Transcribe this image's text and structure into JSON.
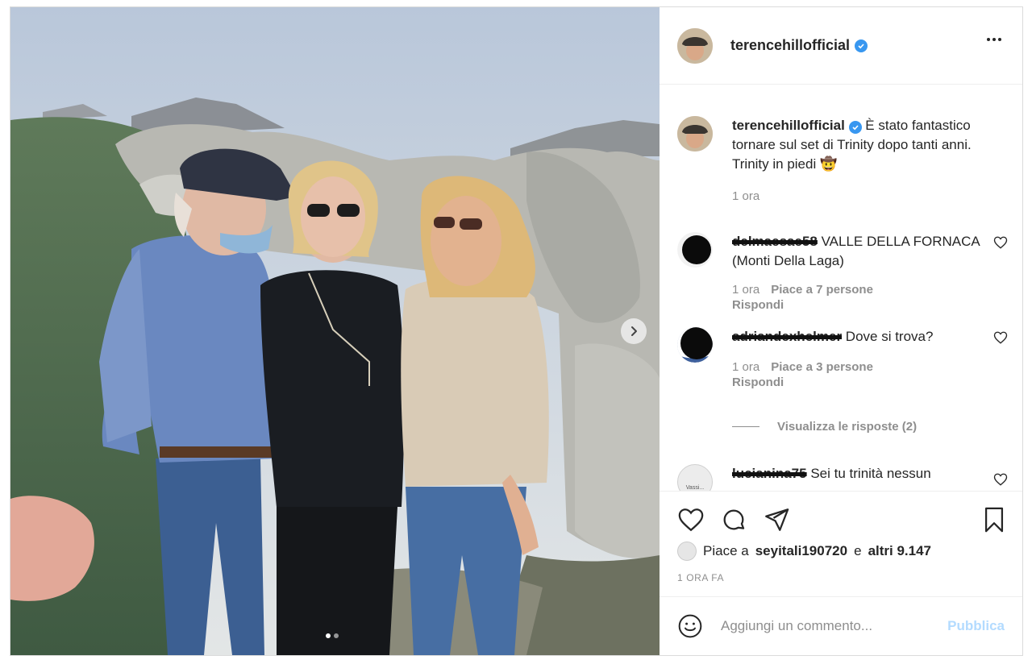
{
  "post": {
    "username": "terencehillofficial",
    "caption": "È stato fantastico tornare sul set di Trinity dopo tanti anni. Trinity in piedi 🤠",
    "caption_time": "1 ora"
  },
  "comments": [
    {
      "username": "delmaesae58",
      "text": "VALLE DELLA FORNACA (Monti Della Laga)",
      "time": "1 ora",
      "likes": "Piace a 7 persone",
      "reply": "Rispondi"
    },
    {
      "username": "adriandexhelmer",
      "text": "Dove si trova?",
      "time": "1 ora",
      "likes": "Piace a 3 persone",
      "reply": "Rispondi"
    },
    {
      "username": "lucianina75",
      "text": "Sei tu trinità nessun",
      "avatar_text": "Vassi..."
    }
  ],
  "view_replies": "Visualizza le risposte (2)",
  "likes": {
    "prefix": "Piace a",
    "user": "seyitali190720",
    "middle": "e",
    "others": "altri 9.147"
  },
  "posted_ago": "1 ORA FA",
  "add_comment": {
    "placeholder": "Aggiungi un commento...",
    "publish_label": "Pubblica"
  },
  "icons": {
    "verified": "verified-badge-icon",
    "more": "more-options-icon",
    "like": "heart-icon",
    "comment": "comment-icon",
    "share": "share-icon",
    "save": "bookmark-icon",
    "emoji": "emoji-icon",
    "next": "chevron-right-icon"
  },
  "colors": {
    "verified": "#3897f0",
    "publish_disabled": "#b3dbff",
    "muted": "#8e8e8e"
  },
  "carousel": {
    "count": 2,
    "active": 1
  }
}
